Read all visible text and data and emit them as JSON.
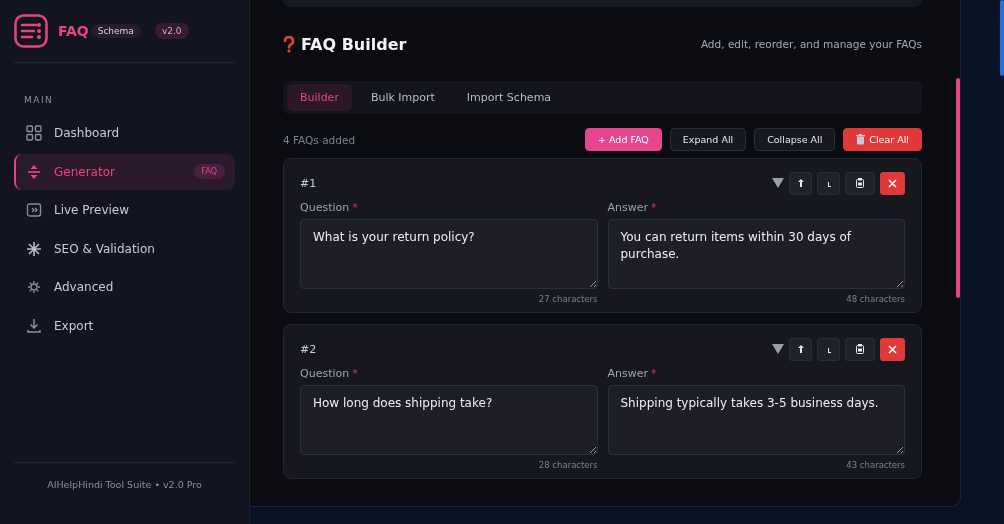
{
  "brand": {
    "name": "FAQ",
    "tag": "Schema",
    "version": "v2.0"
  },
  "sidebar": {
    "section": "MAIN",
    "items": [
      {
        "label": "Dashboard",
        "selected": false
      },
      {
        "label": "Generator",
        "selected": true,
        "badge": "FAQ"
      },
      {
        "label": "Live Preview",
        "selected": false
      },
      {
        "label": "SEO & Validation",
        "selected": false
      },
      {
        "label": "Advanced",
        "selected": false
      },
      {
        "label": "Export",
        "selected": false
      }
    ],
    "footer": "AIHelpHindi Tool Suite • v2.0 Pro"
  },
  "header": {
    "title": "FAQ Builder",
    "subtitle": "Add, edit, reorder, and manage your FAQs"
  },
  "tabs": [
    {
      "label": "Builder",
      "selected": true
    },
    {
      "label": "Bulk Import",
      "selected": false
    },
    {
      "label": "Import Schema",
      "selected": false
    }
  ],
  "toolbar": {
    "count": "4 FAQs added",
    "buttons": [
      {
        "label": "+ Add FAQ",
        "kind": "primary"
      },
      {
        "label": "Expand All",
        "kind": "plain"
      },
      {
        "label": "Collapse All",
        "kind": "plain"
      },
      {
        "label": "Clear All",
        "kind": "danger"
      }
    ]
  },
  "faqs": [
    {
      "number": "#1",
      "question_label": "Question",
      "question_mark": "*",
      "answer_label": "Answer",
      "answer_mark": "*",
      "question": "What is your return policy?",
      "answer": "You can return items within 30 days of purchase.",
      "question_count": "27 characters",
      "answer_count": "48 characters"
    },
    {
      "number": "#2",
      "question_label": "Question",
      "question_mark": "*",
      "answer_label": "Answer",
      "answer_mark": "*",
      "question": "How long does shipping take?",
      "answer": "Shipping typically takes 3-5 business days.",
      "question_count": "28 characters",
      "answer_count": "43 characters"
    }
  ]
}
